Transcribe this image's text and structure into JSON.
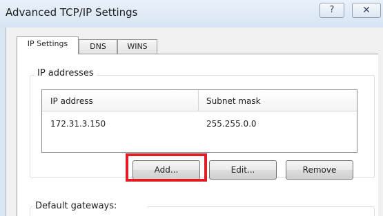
{
  "window": {
    "title": "Advanced TCP/IP Settings",
    "help_glyph": "?",
    "close_glyph": "✕"
  },
  "tabs": [
    {
      "label": "IP Settings",
      "active": true
    },
    {
      "label": "DNS",
      "active": false
    },
    {
      "label": "WINS",
      "active": false
    }
  ],
  "ip_addresses": {
    "group_label": "IP addresses",
    "columns": [
      "IP address",
      "Subnet mask"
    ],
    "rows": [
      {
        "ip": "172.31.3.150",
        "mask": "255.255.0.0"
      }
    ],
    "buttons": {
      "add": "Add...",
      "edit": "Edit...",
      "remove": "Remove"
    }
  },
  "gateways": {
    "group_label": "Default gateways:"
  },
  "colors": {
    "highlight": "#e01c24"
  }
}
